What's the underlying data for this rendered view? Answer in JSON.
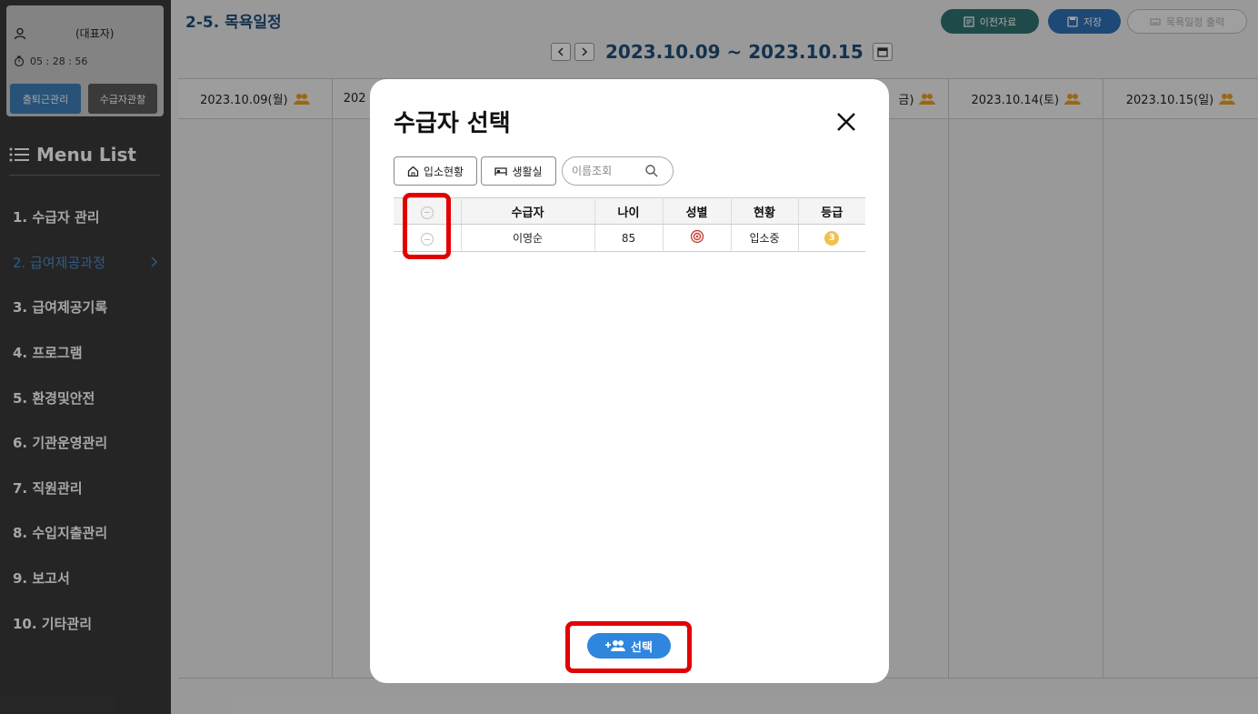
{
  "sidebar": {
    "user_role": "(대표자)",
    "timer": "05 : 28 : 56",
    "attendance_button": "출퇴근관리",
    "observation_button": "수급자관찰",
    "menu_title": "Menu List",
    "items": [
      {
        "label": "1. 수급자 관리"
      },
      {
        "label": "2. 급여제공과정",
        "active": true
      },
      {
        "label": "3. 급여제공기록"
      },
      {
        "label": "4. 프로그램"
      },
      {
        "label": "5. 환경및안전"
      },
      {
        "label": "6. 기관운영관리"
      },
      {
        "label": "7. 직원관리"
      },
      {
        "label": "8. 수입지출관리"
      },
      {
        "label": "9. 보고서"
      },
      {
        "label": "10. 기타관리"
      }
    ]
  },
  "main": {
    "page_title": "2-5. 목욕일정",
    "prev_data_button": "이전자료",
    "save_button": "저장",
    "print_button": "목욕일정 출력",
    "date_range": "2023.10.09 ~ 2023.10.15",
    "days": [
      "2023.10.09(월)",
      "202",
      "",
      "",
      "",
      "2023.10.14(토)",
      "2023.10.15(일)"
    ],
    "partial_day_suffix": "금)"
  },
  "modal": {
    "title": "수급자 선택",
    "filter_admission": "입소현황",
    "filter_room": "생활실",
    "search_placeholder": "이름조회",
    "columns": [
      "",
      "수급자",
      "나이",
      "성별",
      "현황",
      "등급"
    ],
    "rows": [
      {
        "name": "이영순",
        "age": "85",
        "gender_icon": "female-icon",
        "status": "입소중",
        "grade": "3"
      }
    ],
    "select_button": "선택"
  },
  "colors": {
    "accent": "#2e86de",
    "title_blue": "#1f4e79",
    "highlight": "#e30000",
    "grade_badge": "#f2c14e"
  }
}
